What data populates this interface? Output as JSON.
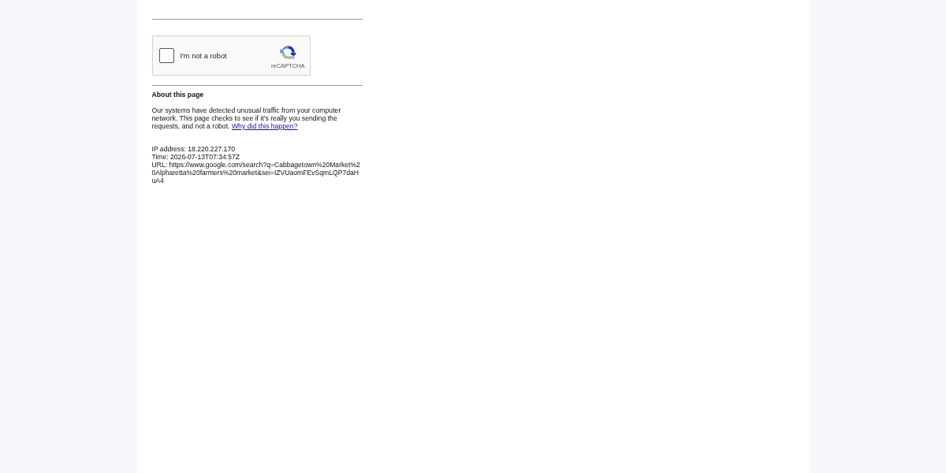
{
  "captcha": {
    "checkbox": {
      "label": "I'm not a robot",
      "checked": false
    },
    "logo_text": "reCAPTCHA"
  },
  "about": {
    "heading": "About this page",
    "paragraph": "Our systems have detected unusual traffic from your computer network. This page checks to see if it's really you sending the requests, and not a robot.",
    "link": "Why did this happen?"
  },
  "details": [
    "IP address: 18.220.227.170",
    "Time: 2026-07-13T07:34:57Z",
    "URL: https://www.google.com/search?q=Cabbagetown%20Market%20Alpharetta%20farmers%20market&sei=IZVUaomFEvSqmLQP7daHuA4"
  ]
}
